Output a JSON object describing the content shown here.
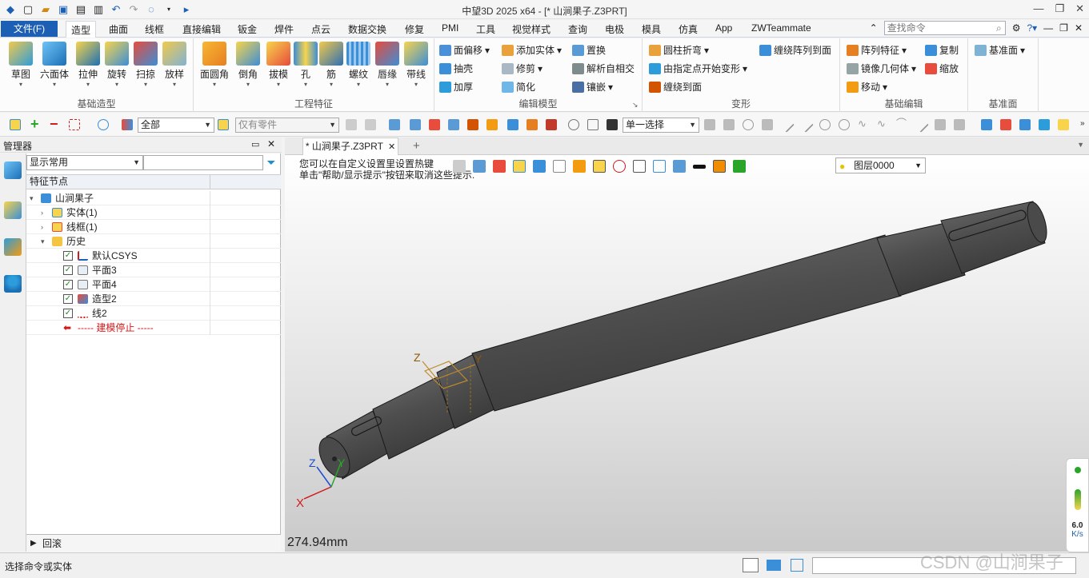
{
  "window": {
    "title": "中望3D 2025 x64 - [* 山涧果子.Z3PRT]"
  },
  "menu": {
    "file": "文件(F)",
    "tabs": [
      "造型",
      "曲面",
      "线框",
      "直接编辑",
      "钣金",
      "焊件",
      "点云",
      "数据交换",
      "修复",
      "PMI",
      "工具",
      "视觉样式",
      "查询",
      "电极",
      "模具",
      "仿真",
      "App",
      "ZWTeammate"
    ],
    "search_placeholder": "查找命令"
  },
  "ribbon": {
    "basic": {
      "label": "基础造型",
      "buttons": [
        "草图",
        "六面体",
        "拉伸",
        "旋转",
        "扫掠",
        "放样"
      ]
    },
    "eng": {
      "label": "工程特征",
      "buttons": [
        "面圆角",
        "倒角",
        "拔模",
        "孔",
        "筋",
        "螺纹",
        "唇缘",
        "带线"
      ]
    },
    "edit": {
      "label": "编辑模型",
      "items": [
        "面偏移",
        "添加实体",
        "置换",
        "抽壳",
        "修剪",
        "解析自相交",
        "加厚",
        "简化",
        "镶嵌"
      ]
    },
    "deform": {
      "label": "变形",
      "items": [
        "圆柱折弯",
        "缠绕阵列到面",
        "由指定点开始变形",
        "缠绕到面"
      ]
    },
    "basicedit": {
      "label": "基础编辑",
      "items": [
        "阵列特征",
        "复制",
        "镜像几何体",
        "缩放",
        "移动"
      ]
    },
    "datum": {
      "label": "基准面",
      "items": [
        "基准面"
      ]
    }
  },
  "toolbar": {
    "filter_value": "全部",
    "part_filter": "仅有零件",
    "select_mode": "单一选择"
  },
  "manager": {
    "title": "管理器",
    "filter": "显示常用",
    "header": "特征节点",
    "tree": [
      {
        "label": "山涧果子"
      },
      {
        "label": "实体(1)"
      },
      {
        "label": "线框(1)"
      },
      {
        "label": "历史"
      },
      {
        "label": "默认CSYS"
      },
      {
        "label": "平面3"
      },
      {
        "label": "平面4"
      },
      {
        "label": "造型2"
      },
      {
        "label": "线2"
      },
      {
        "label": "----- 建模停止 -----"
      }
    ],
    "rollback": "回滚"
  },
  "document": {
    "tab": "* 山涧果子.Z3PRT",
    "hint_line1": "您可以在自定义设置里设置热键",
    "hint_line2": "单击\"帮助/显示提示\"按钮来取消这些提示.",
    "layer": "图层0000",
    "distance": "274.94mm"
  },
  "axes": {
    "x": "X",
    "y": "Y",
    "z": "Z"
  },
  "status": {
    "message": "选择命令或实体"
  },
  "perf": {
    "fps": "6.0",
    "unit": "K/s"
  },
  "watermark": "CSDN @山涧果子",
  "colors": {
    "accent": "#1d5fb4",
    "shaft": "#555555",
    "stop": "#d11a1a"
  }
}
